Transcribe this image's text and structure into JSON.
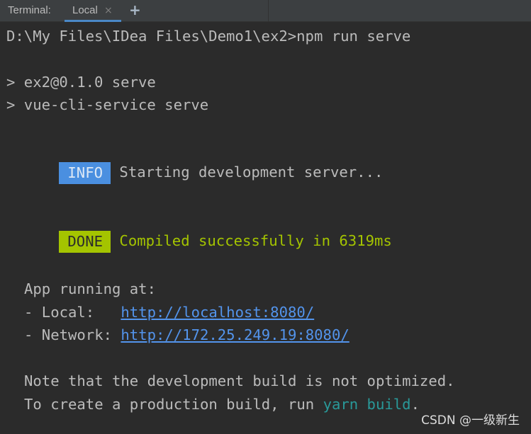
{
  "tabbar": {
    "title": "Terminal:",
    "tabs": [
      {
        "label": "Local",
        "close_glyph": "×"
      }
    ],
    "add_glyph": "+"
  },
  "terminal": {
    "prompt_line": "D:\\My Files\\IDea Files\\Demo1\\ex2>npm run serve",
    "npm_line1": "> ex2@0.1.0 serve",
    "npm_line2": "> vue-cli-service serve",
    "info_badge": "INFO",
    "info_text": " Starting development server...",
    "done_badge": "DONE",
    "done_text": " Compiled successfully in 6319ms",
    "app_running": "App running at:",
    "local_label": "- Local:   ",
    "local_url": "http://localhost:8080/",
    "network_label": "- Network: ",
    "network_url": "http://172.25.249.19:8080/",
    "note_line": "Note that the development build is not optimized.",
    "prod_prefix": "To create a production build, run ",
    "prod_cmd": "yarn build",
    "prod_suffix": "."
  },
  "watermark": "CSDN @一级新生",
  "colors": {
    "background": "#2b2b2b",
    "tabbar": "#3c3f41",
    "tab_underline": "#4a88c7",
    "info_badge": "#4a8fe0",
    "done_badge": "#a4c400",
    "link": "#5394ec",
    "command": "#299999",
    "text": "#bbbbbb"
  }
}
